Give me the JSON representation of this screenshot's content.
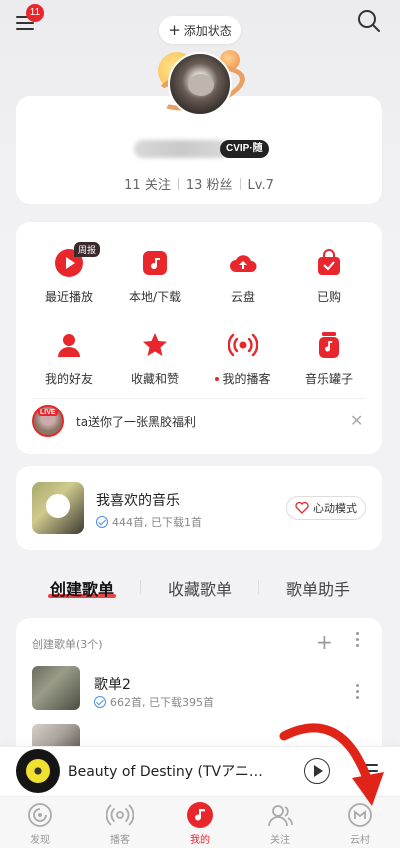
{
  "colors": {
    "accent": "#e8262b",
    "background": "#f2f2f4"
  },
  "topbar": {
    "menu_badge": "11",
    "add_status_label": "添加状态",
    "menu_icon": "menu-icon",
    "search_icon": "search-icon"
  },
  "profile": {
    "vip_badge": "CVIP·随",
    "follows": "11 关注",
    "fans": "13 粉丝",
    "level": "Lv.7"
  },
  "grid": {
    "items": [
      {
        "label": "最近播放",
        "icon": "play-circle-icon",
        "tag": "周报"
      },
      {
        "label": "本地/下载",
        "icon": "music-note-icon"
      },
      {
        "label": "云盘",
        "icon": "cloud-upload-icon"
      },
      {
        "label": "已购",
        "icon": "shopping-bag-icon"
      },
      {
        "label": "我的好友",
        "icon": "friends-icon"
      },
      {
        "label": "收藏和赞",
        "icon": "star-icon"
      },
      {
        "label": "我的播客",
        "icon": "podcast-icon"
      },
      {
        "label": "音乐罐子",
        "icon": "music-jar-icon"
      }
    ],
    "notice_text": "ta送你了一张黑胶福利",
    "live_tag": "LIVE"
  },
  "liked": {
    "title": "我喜欢的音乐",
    "subtitle": "444首, 已下载1首",
    "mode_label": "心动模式"
  },
  "tabs": [
    "创建歌单",
    "收藏歌单",
    "歌单助手"
  ],
  "playlists": {
    "header": "创建歌单(3个)",
    "items": [
      {
        "name": "歌单2",
        "subtitle": "662首, 已下载395首"
      }
    ]
  },
  "player": {
    "song_title": "Beauty of Destiny (TVアニ…"
  },
  "bottom_nav": [
    {
      "label": "发现",
      "icon": "discover-icon"
    },
    {
      "label": "播客",
      "icon": "podcast-icon"
    },
    {
      "label": "我的",
      "icon": "my-music-icon",
      "active": true
    },
    {
      "label": "关注",
      "icon": "follow-icon"
    },
    {
      "label": "云村",
      "icon": "cloud-village-icon"
    }
  ]
}
